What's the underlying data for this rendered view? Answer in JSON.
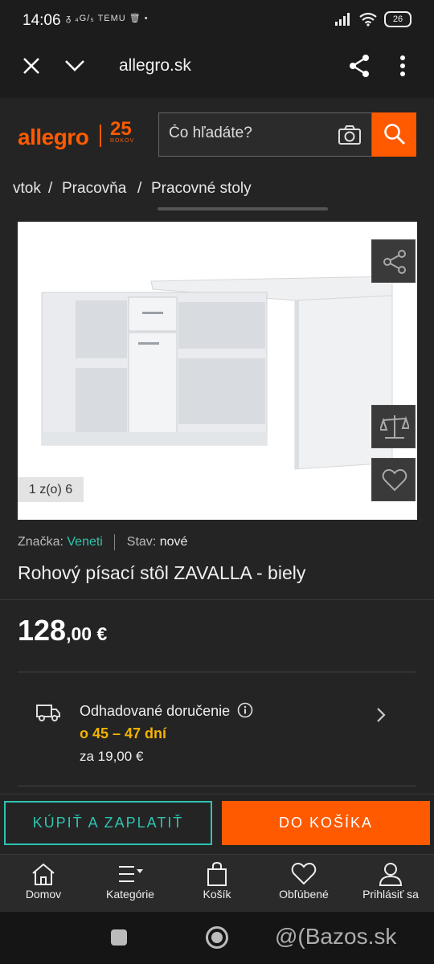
{
  "status_bar": {
    "time": "14:06",
    "notif_text": "ᵹ ₄G/₅ TEMU 🗑 •",
    "battery": "26"
  },
  "browser": {
    "url": "allegro.sk"
  },
  "header": {
    "logo": "allegro",
    "anniversary": "25",
    "anniversary_sub": "ROKOV",
    "search_placeholder": "Čo hľadáte?"
  },
  "breadcrumb": {
    "items": [
      "vtok",
      "/",
      "Pracovňa",
      "/",
      "Pracovné stoly"
    ]
  },
  "gallery": {
    "counter": "1 z(o) 6"
  },
  "product": {
    "brand_label": "Značka:",
    "brand": "Veneti",
    "condition_label": "Stav:",
    "condition": "nové",
    "title": "Rohový písací stôl ZAVALLA - biely",
    "price_whole": "128",
    "price_fraction": ",00 €"
  },
  "delivery": {
    "title": "Odhadované doručenie",
    "days": "o 45 – 47 dní",
    "cost": "za 19,00 €"
  },
  "actions": {
    "buy": "KÚPIŤ A ZAPLATIŤ",
    "cart": "DO KOŠÍKA"
  },
  "nav": {
    "items": [
      {
        "label": "Domov",
        "icon": "home-icon"
      },
      {
        "label": "Kategórie",
        "icon": "menu-icon"
      },
      {
        "label": "Košík",
        "icon": "bag-icon"
      },
      {
        "label": "Obľúbené",
        "icon": "heart-icon"
      },
      {
        "label": "Prihlásiť sa",
        "icon": "user-icon"
      }
    ]
  },
  "watermark": "@(Bazos.sk",
  "colors": {
    "accent": "#ff5a00",
    "teal": "#2ec4b0",
    "delivery": "#f3b300",
    "background": "#242424"
  }
}
